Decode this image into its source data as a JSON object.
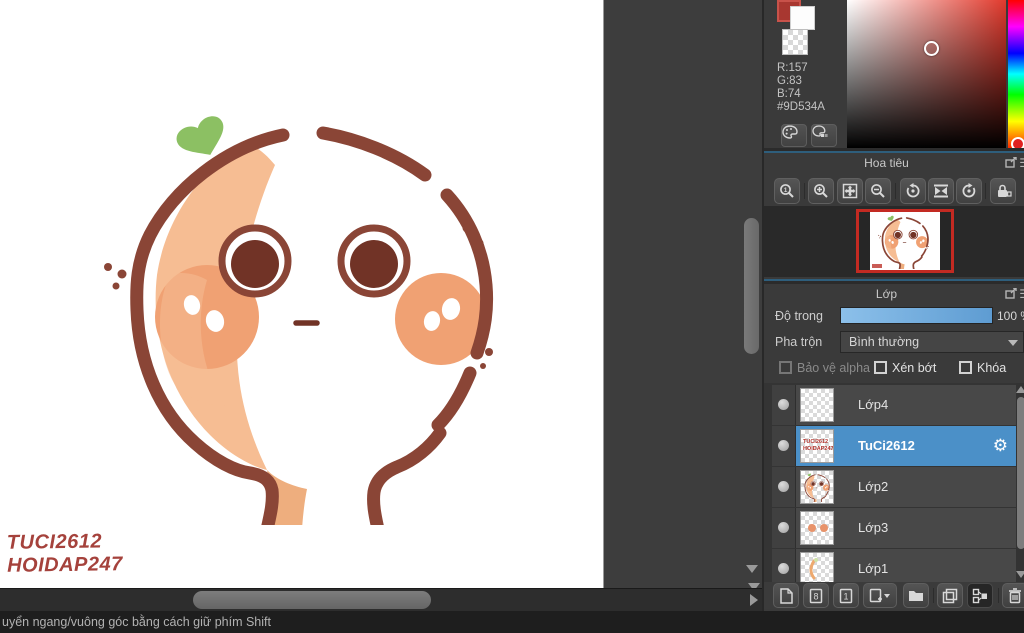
{
  "status": {
    "text": "uyển ngang/vuông góc bằng cách giữ phím Shift"
  },
  "canvas": {
    "watermark_line1": "TUCI2612",
    "watermark_line2": "HOIDAP247"
  },
  "color_panel": {
    "r_label": "R:157",
    "g_label": "G:83",
    "b_label": "B:74",
    "hex_label": "#9D534A",
    "foreground_hex": "#9D534A",
    "icons": {
      "palette": "palette-icon",
      "palette_set": "palette-swatches-icon"
    }
  },
  "navigator": {
    "title": "Hoa tiêu",
    "icons": [
      "zoom-100-icon",
      "zoom-in-icon",
      "fit-screen-icon",
      "zoom-out-icon",
      "rotate-ccw-icon",
      "reset-rotation-icon",
      "rotate-cw-icon",
      "rotate-lock-icon"
    ]
  },
  "layers": {
    "title": "Lớp",
    "opacity_label": "Độ trong",
    "opacity_value": "100 %",
    "opacity_percent": 100,
    "blend_label": "Pha trộn",
    "blend_value": "Bình thường",
    "checkbox_alpha": "Bảo vệ alpha",
    "checkbox_clip": "Xén bớt",
    "checkbox_lock": "Khóa",
    "items": [
      {
        "name": "Lớp4",
        "selected": false
      },
      {
        "name": "TuCi2612",
        "selected": true
      },
      {
        "name": "Lớp2",
        "selected": false
      },
      {
        "name": "Lớp3",
        "selected": false
      },
      {
        "name": "Lớp1",
        "selected": false
      }
    ],
    "toolbar": {
      "bit8_label": "8",
      "bit1_label": "1",
      "icons": [
        "new-layer-icon",
        "layer-8bit-icon",
        "layer-1bit-icon",
        "add-layer-icon",
        "folder-icon",
        "duplicate-layer-icon",
        "merge-layer-icon",
        "delete-layer-icon"
      ]
    },
    "gear_glyph": "⚙"
  },
  "colors": {
    "selection_blue": "#4b90c8",
    "slider_blue": "#6fb0e2",
    "panel_divider_teal": "#2e5e7c",
    "picked_red": "#a83730",
    "outline_brown": "#8a4536",
    "cheek_orange": "#f0a173",
    "leaf_green": "#8cc063"
  }
}
